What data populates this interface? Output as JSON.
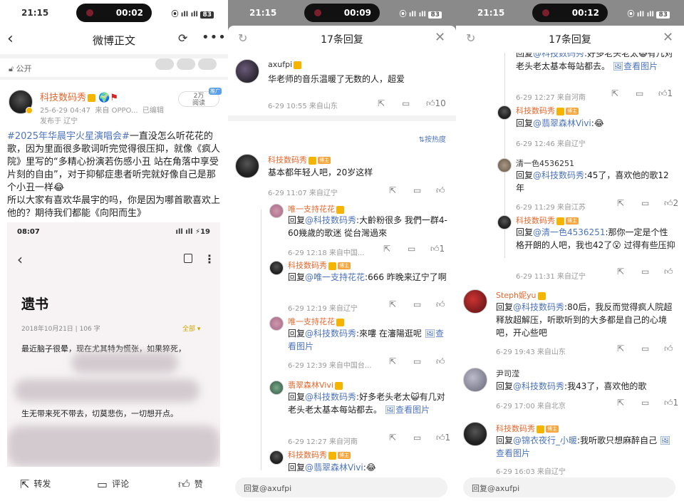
{
  "status": {
    "p1": {
      "time": "21:15",
      "pill": "00:02",
      "signal": "⦿ ıll ıll",
      "battery": "83"
    },
    "p2": {
      "time": "21:15",
      "pill": "00:09",
      "signal": "⦿ ıll ıll",
      "battery": "83"
    },
    "p3": {
      "time": "21:15",
      "pill": "00:12",
      "signal": "⦿ ıll ıll",
      "battery": "83"
    }
  },
  "post": {
    "title": "微博正文",
    "public_label": "公开",
    "author": "科技数码秀",
    "time": "25-6-29 04:47",
    "source": "来自 OPPO...",
    "edited": "已编辑",
    "location": "发布于 辽宁",
    "reads": "2万",
    "reads_label": "阅读",
    "reads_tag": "推广",
    "hashtag": "#2025年华晨宇火星演唱会#",
    "body1": "一直没怎么听花花的歌，因为里面很多歌词听完觉得很压抑，就像《疯人院》里写的“多精心扮演若伤感小丑 站在角落中享受片刻的自由”，对于抑郁症患者听完就好像自己是那个小丑一样😂",
    "body2": "所以大家有喜欢华晨宇的吗，你是因为哪首歌喜欢上他的？期待我们都能《向阳而生》",
    "screenshot": {
      "time": "08:07",
      "status_right": "ıll ıll ⚡19",
      "heading": "遗书",
      "date": "2018年10月21日 | 106 字",
      "all": "全部 ▾",
      "line1": "最近脑子很晕，现在尤其特为慌张，如果猝死，",
      "line2": "生无带来死不带去，切莫悲伤，一切想开点。"
    },
    "actions": {
      "repost": "转发",
      "comment": "评论",
      "like": "赞"
    }
  },
  "sheet2": {
    "title": "17条回复",
    "top_comment": {
      "name": "axufpi",
      "text": "华老师的音乐温暖了无数的人，超爱",
      "meta": "6-29 10:55  来自山东",
      "likes": "10"
    },
    "sort_label": "⇅按热度",
    "replies": [
      {
        "name": "科技数码秀",
        "tag": "博主",
        "text": "基本都年轻人吧，20岁这样",
        "meta": "6-29 11:07  来自辽宁",
        "likes": ""
      },
      {
        "name": "唯一支持花花",
        "text": "回复@科技数码秀:大齡粉很多 我們一群4-60幾歲的歌迷 從台灣過來",
        "meta": "6-29 12:18  来自中国...",
        "likes": "1"
      },
      {
        "name": "科技数码秀",
        "tag": "博主",
        "text": "回复@唯一支持花花:666 昨晚来辽宁了啊",
        "meta": "6-29 12:19  来自辽宁",
        "likes": ""
      },
      {
        "name": "唯一支持花花",
        "text": "回复@科技数码秀:來嘍 在瀋陽逛呢 🖼查看图片",
        "meta": "6-29 12:39  来自中国台...",
        "likes": ""
      },
      {
        "name": "翡翠森林Vivi",
        "text": "回复@科技数码秀:好多老头老太😺有几对老头老太基本每站都去。 🖼查看图片",
        "meta": "6-29 12:27  来自河南",
        "likes": "1"
      },
      {
        "name": "科技数码秀",
        "tag": "博主",
        "text": "回复@翡翠森林Vivi:😂",
        "meta": "",
        "likes": ""
      }
    ],
    "reply_placeholder": "回复@axufpi"
  },
  "sheet3": {
    "title": "17条回复",
    "replies": [
      {
        "text": "回复@科技数码秀:好多老头老太😺有几对老头老太基本每站都去。 🖼查看图片",
        "meta": "6-29 12:27  来自河南",
        "likes": "1"
      },
      {
        "name": "科技数码秀",
        "tag": "博主",
        "text": "回复@翡翠森林Vivi:😂",
        "meta": "6-29 12:46  来自辽宁",
        "likes": ""
      },
      {
        "name": "清一色4536251",
        "text": "回复@科技数码秀:45了，喜欢他的歌12年",
        "meta": "6-29 11:29  来自江苏",
        "likes": "2"
      },
      {
        "name": "科技数码秀",
        "tag": "博主",
        "text": "回复@清一色4536251:那你一定是个性格开朗的人吧，我也42了😮 过得有些压抑",
        "meta": "6-29 11:31  来自辽宁",
        "likes": ""
      },
      {
        "name": "Steph妮yu",
        "text": "回复@科技数码秀:80后，我反而觉得疯人院超释放超解压，听歌听到的大多都是自己的心境吧，开心些吧",
        "meta": "6-29 19:43  来自山东",
        "likes": ""
      },
      {
        "name": "尹司滢",
        "text": "回复@科技数码秀:我43了，喜欢他的歌",
        "meta": "6-29 17:00  来自北京",
        "likes": "1"
      },
      {
        "name": "科技数码秀",
        "tag": "博主",
        "text": "回复@锦衣夜行_小暖:我听歌只想麻醉自己 🖼查看图片",
        "meta": "6-29 16:03  来自辽宁",
        "likes": ""
      }
    ],
    "reply_placeholder": "回复@axufpi"
  },
  "icons": {
    "share": "⟲",
    "comment": "▭",
    "like": "👍",
    "close": "✕",
    "refresh": "↻",
    "back": "‹",
    "more": "•••"
  }
}
